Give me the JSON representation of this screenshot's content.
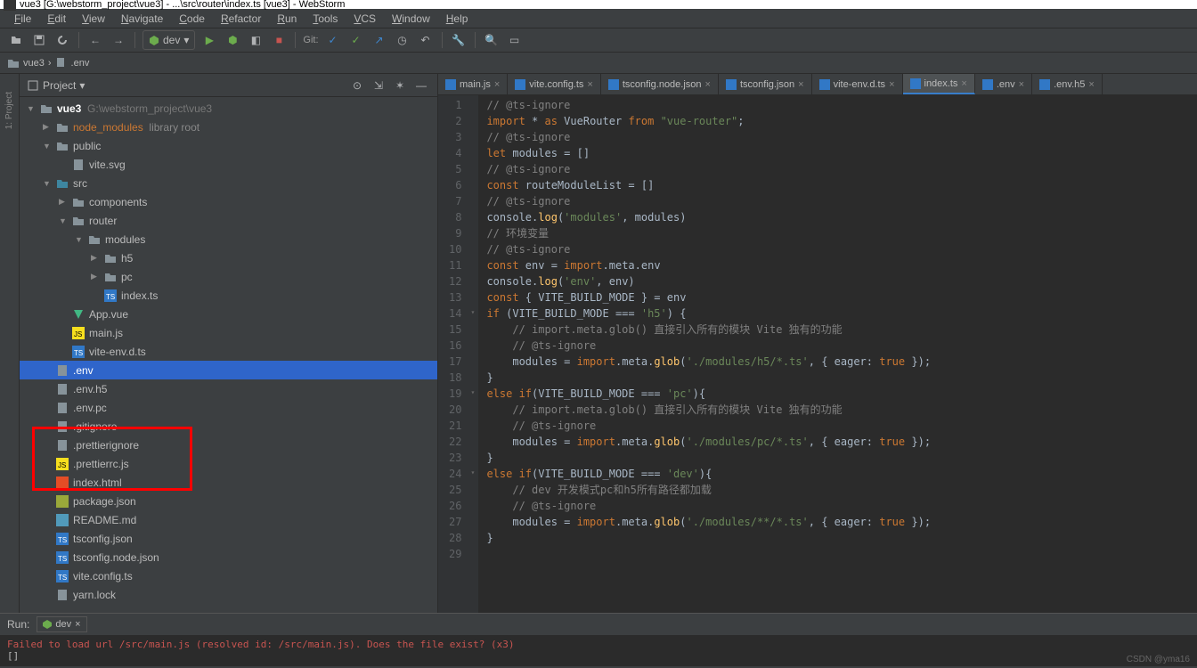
{
  "title": "vue3 [G:\\webstorm_project\\vue3] - ...\\src\\router\\index.ts [vue3] - WebStorm",
  "menu": [
    "File",
    "Edit",
    "View",
    "Navigate",
    "Code",
    "Refactor",
    "Run",
    "Tools",
    "VCS",
    "Window",
    "Help"
  ],
  "toolbar": {
    "run_config": "dev",
    "git_label": "Git:"
  },
  "breadcrumb": [
    "vue3",
    ".env"
  ],
  "project": {
    "header": "Project",
    "root_name": "vue3",
    "root_path": "G:\\webstorm_project\\vue3",
    "tree": [
      {
        "depth": 1,
        "arrow": "▶",
        "icon": "folder",
        "name": "node_modules",
        "extra": "library root",
        "libroot": true
      },
      {
        "depth": 1,
        "arrow": "▼",
        "icon": "folder",
        "name": "public"
      },
      {
        "depth": 2,
        "arrow": "",
        "icon": "file",
        "name": "vite.svg"
      },
      {
        "depth": 1,
        "arrow": "▼",
        "icon": "folder-src",
        "name": "src"
      },
      {
        "depth": 2,
        "arrow": "▶",
        "icon": "folder",
        "name": "components"
      },
      {
        "depth": 2,
        "arrow": "▼",
        "icon": "folder",
        "name": "router"
      },
      {
        "depth": 3,
        "arrow": "▼",
        "icon": "folder",
        "name": "modules"
      },
      {
        "depth": 4,
        "arrow": "▶",
        "icon": "folder",
        "name": "h5"
      },
      {
        "depth": 4,
        "arrow": "▶",
        "icon": "folder",
        "name": "pc"
      },
      {
        "depth": 4,
        "arrow": "",
        "icon": "ts",
        "name": "index.ts"
      },
      {
        "depth": 2,
        "arrow": "",
        "icon": "vue",
        "name": "App.vue"
      },
      {
        "depth": 2,
        "arrow": "",
        "icon": "js",
        "name": "main.js"
      },
      {
        "depth": 2,
        "arrow": "",
        "icon": "ts",
        "name": "vite-env.d.ts"
      },
      {
        "depth": 1,
        "arrow": "",
        "icon": "file",
        "name": ".env",
        "selected": true
      },
      {
        "depth": 1,
        "arrow": "",
        "icon": "file",
        "name": ".env.h5"
      },
      {
        "depth": 1,
        "arrow": "",
        "icon": "file",
        "name": ".env.pc"
      },
      {
        "depth": 1,
        "arrow": "",
        "icon": "file",
        "name": ".gitignore"
      },
      {
        "depth": 1,
        "arrow": "",
        "icon": "file",
        "name": ".prettierignore"
      },
      {
        "depth": 1,
        "arrow": "",
        "icon": "js",
        "name": ".prettierrc.js"
      },
      {
        "depth": 1,
        "arrow": "",
        "icon": "html",
        "name": "index.html"
      },
      {
        "depth": 1,
        "arrow": "",
        "icon": "json",
        "name": "package.json"
      },
      {
        "depth": 1,
        "arrow": "",
        "icon": "md",
        "name": "README.md"
      },
      {
        "depth": 1,
        "arrow": "",
        "icon": "ts",
        "name": "tsconfig.json"
      },
      {
        "depth": 1,
        "arrow": "",
        "icon": "ts",
        "name": "tsconfig.node.json"
      },
      {
        "depth": 1,
        "arrow": "",
        "icon": "ts",
        "name": "vite.config.ts"
      },
      {
        "depth": 1,
        "arrow": "",
        "icon": "file",
        "name": "yarn.lock"
      }
    ]
  },
  "tabs": [
    {
      "name": "main.js",
      "active": false
    },
    {
      "name": "vite.config.ts",
      "active": false
    },
    {
      "name": "tsconfig.node.json",
      "active": false
    },
    {
      "name": "tsconfig.json",
      "active": false
    },
    {
      "name": "vite-env.d.ts",
      "active": false
    },
    {
      "name": "index.ts",
      "active": true
    },
    {
      "name": ".env",
      "active": false
    },
    {
      "name": ".env.h5",
      "active": false
    }
  ],
  "code_lines": [
    {
      "n": 1,
      "html": "<span class='com'>// @ts-ignore</span>"
    },
    {
      "n": 2,
      "html": "<span class='kw'>import</span> * <span class='kw'>as</span> VueRouter <span class='kw'>from</span> <span class='str'>\"vue-router\"</span>;"
    },
    {
      "n": 3,
      "html": "<span class='com'>// @ts-ignore</span>"
    },
    {
      "n": 4,
      "html": "<span class='kw'>let</span> modules = []"
    },
    {
      "n": 5,
      "html": "<span class='com'>// @ts-ignore</span>"
    },
    {
      "n": 6,
      "html": "<span class='kw'>const</span> routeModuleList = []"
    },
    {
      "n": 7,
      "html": "<span class='com'>// @ts-ignore</span>"
    },
    {
      "n": 8,
      "html": "console.<span class='fn'>log</span>(<span class='str'>'modules'</span>, modules)"
    },
    {
      "n": 9,
      "html": "<span class='com'>// 环境变量</span>"
    },
    {
      "n": 10,
      "html": "<span class='com'>// @ts-ignore</span>"
    },
    {
      "n": 11,
      "html": "<span class='kw'>const</span> env = <span class='kw'>import</span>.meta.env"
    },
    {
      "n": 12,
      "html": "console.<span class='fn'>log</span>(<span class='str'>'env'</span>, env)"
    },
    {
      "n": 13,
      "html": "<span class='kw'>const</span> { VITE_BUILD_MODE } = env"
    },
    {
      "n": 14,
      "html": "<span class='kw'>if</span> (VITE_BUILD_MODE === <span class='str'>'h5'</span>) {"
    },
    {
      "n": 15,
      "html": "    <span class='com'>// import.meta.glob() 直接引入所有的模块 Vite 独有的功能</span>"
    },
    {
      "n": 16,
      "html": "    <span class='com'>// @ts-ignore</span>"
    },
    {
      "n": 17,
      "html": "    modules = <span class='kw'>import</span>.meta.<span class='fn'>glob</span>(<span class='str'>'./modules/h5/*.ts'</span>, { eager: <span class='kw'>true</span> });"
    },
    {
      "n": 18,
      "html": "}"
    },
    {
      "n": 19,
      "html": "<span class='kw'>else if</span>(VITE_BUILD_MODE === <span class='str'>'pc'</span>){"
    },
    {
      "n": 20,
      "html": "    <span class='com'>// import.meta.glob() 直接引入所有的模块 Vite 独有的功能</span>"
    },
    {
      "n": 21,
      "html": "    <span class='com'>// @ts-ignore</span>"
    },
    {
      "n": 22,
      "html": "    modules = <span class='kw'>import</span>.meta.<span class='fn'>glob</span>(<span class='str'>'./modules/pc/*.ts'</span>, { eager: <span class='kw'>true</span> });"
    },
    {
      "n": 23,
      "html": "}"
    },
    {
      "n": 24,
      "html": "<span class='kw'>else if</span>(VITE_BUILD_MODE === <span class='str'>'dev'</span>){"
    },
    {
      "n": 25,
      "html": "    <span class='com'>// dev 开发模式pc和h5所有路径都加载</span>"
    },
    {
      "n": 26,
      "html": "    <span class='com'>// @ts-ignore</span>"
    },
    {
      "n": 27,
      "html": "    modules = <span class='kw'>import</span>.meta.<span class='fn'>glob</span>(<span class='str'>'./modules/**/*.ts'</span>, { eager: <span class='kw'>true</span> });"
    },
    {
      "n": 28,
      "html": "}"
    },
    {
      "n": 29,
      "html": ""
    }
  ],
  "run": {
    "label": "Run:",
    "tab": "dev",
    "output": "Failed to load url /src/main.js (resolved id: /src/main.js). Does the file exist? (x3)",
    "prompt": "[]"
  },
  "watermark": "CSDN @yma16"
}
